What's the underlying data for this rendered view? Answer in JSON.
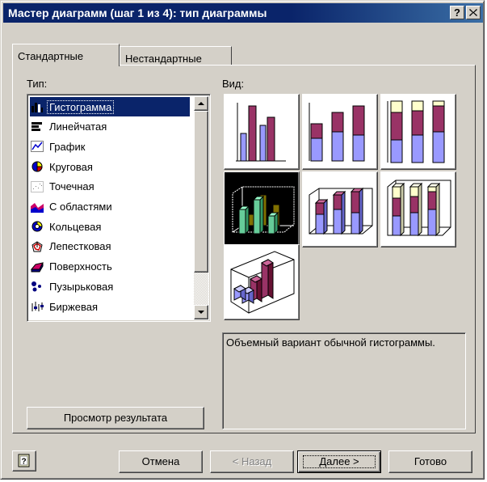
{
  "window": {
    "title": "Мастер диаграмм (шаг 1 из 4): тип диаграммы",
    "help_btn": "?",
    "close_btn": "✕"
  },
  "tabs": [
    {
      "label": "Стандартные",
      "active": true
    },
    {
      "label": "Нестандартные",
      "active": false
    }
  ],
  "type_section": {
    "label": "Тип:",
    "items": [
      {
        "label": "Гистограмма",
        "icon": "bar-chart-icon",
        "selected": true
      },
      {
        "label": "Линейчатая",
        "icon": "horizontal-bar-icon",
        "selected": false
      },
      {
        "label": "График",
        "icon": "line-chart-icon",
        "selected": false
      },
      {
        "label": "Круговая",
        "icon": "pie-chart-icon",
        "selected": false
      },
      {
        "label": "Точечная",
        "icon": "scatter-chart-icon",
        "selected": false
      },
      {
        "label": "С областями",
        "icon": "area-chart-icon",
        "selected": false
      },
      {
        "label": "Кольцевая",
        "icon": "doughnut-chart-icon",
        "selected": false
      },
      {
        "label": "Лепестковая",
        "icon": "radar-chart-icon",
        "selected": false
      },
      {
        "label": "Поверхность",
        "icon": "surface-chart-icon",
        "selected": false
      },
      {
        "label": "Пузырьковая",
        "icon": "bubble-chart-icon",
        "selected": false
      },
      {
        "label": "Биржевая",
        "icon": "stock-chart-icon",
        "selected": false
      }
    ]
  },
  "view_section": {
    "label": "Вид:",
    "subtypes": [
      {
        "name": "clustered-column-subtype",
        "selected": false
      },
      {
        "name": "stacked-column-subtype",
        "selected": false
      },
      {
        "name": "100-stacked-column-subtype",
        "selected": false
      },
      {
        "name": "3d-clustered-column-subtype",
        "selected": true
      },
      {
        "name": "3d-stacked-column-subtype",
        "selected": false
      },
      {
        "name": "3d-100-stacked-column-subtype",
        "selected": false
      },
      {
        "name": "3d-column-subtype",
        "selected": false
      }
    ],
    "description": "Объемный вариант обычной гистограммы."
  },
  "preview_button": "Просмотр результата",
  "footer": {
    "help_icon": "help-icon",
    "cancel": "Отмена",
    "back": "< Назад",
    "next": "Далее >",
    "finish": "Готово"
  },
  "colors": {
    "titlebar": "#0a246a",
    "face": "#d4d0c8",
    "selection": "#0a246a",
    "series1": "#9999ff",
    "series2": "#993366",
    "series3": "#ffffcc",
    "series_3d_front": "#66cc99",
    "series_3d_back": "#807000"
  }
}
